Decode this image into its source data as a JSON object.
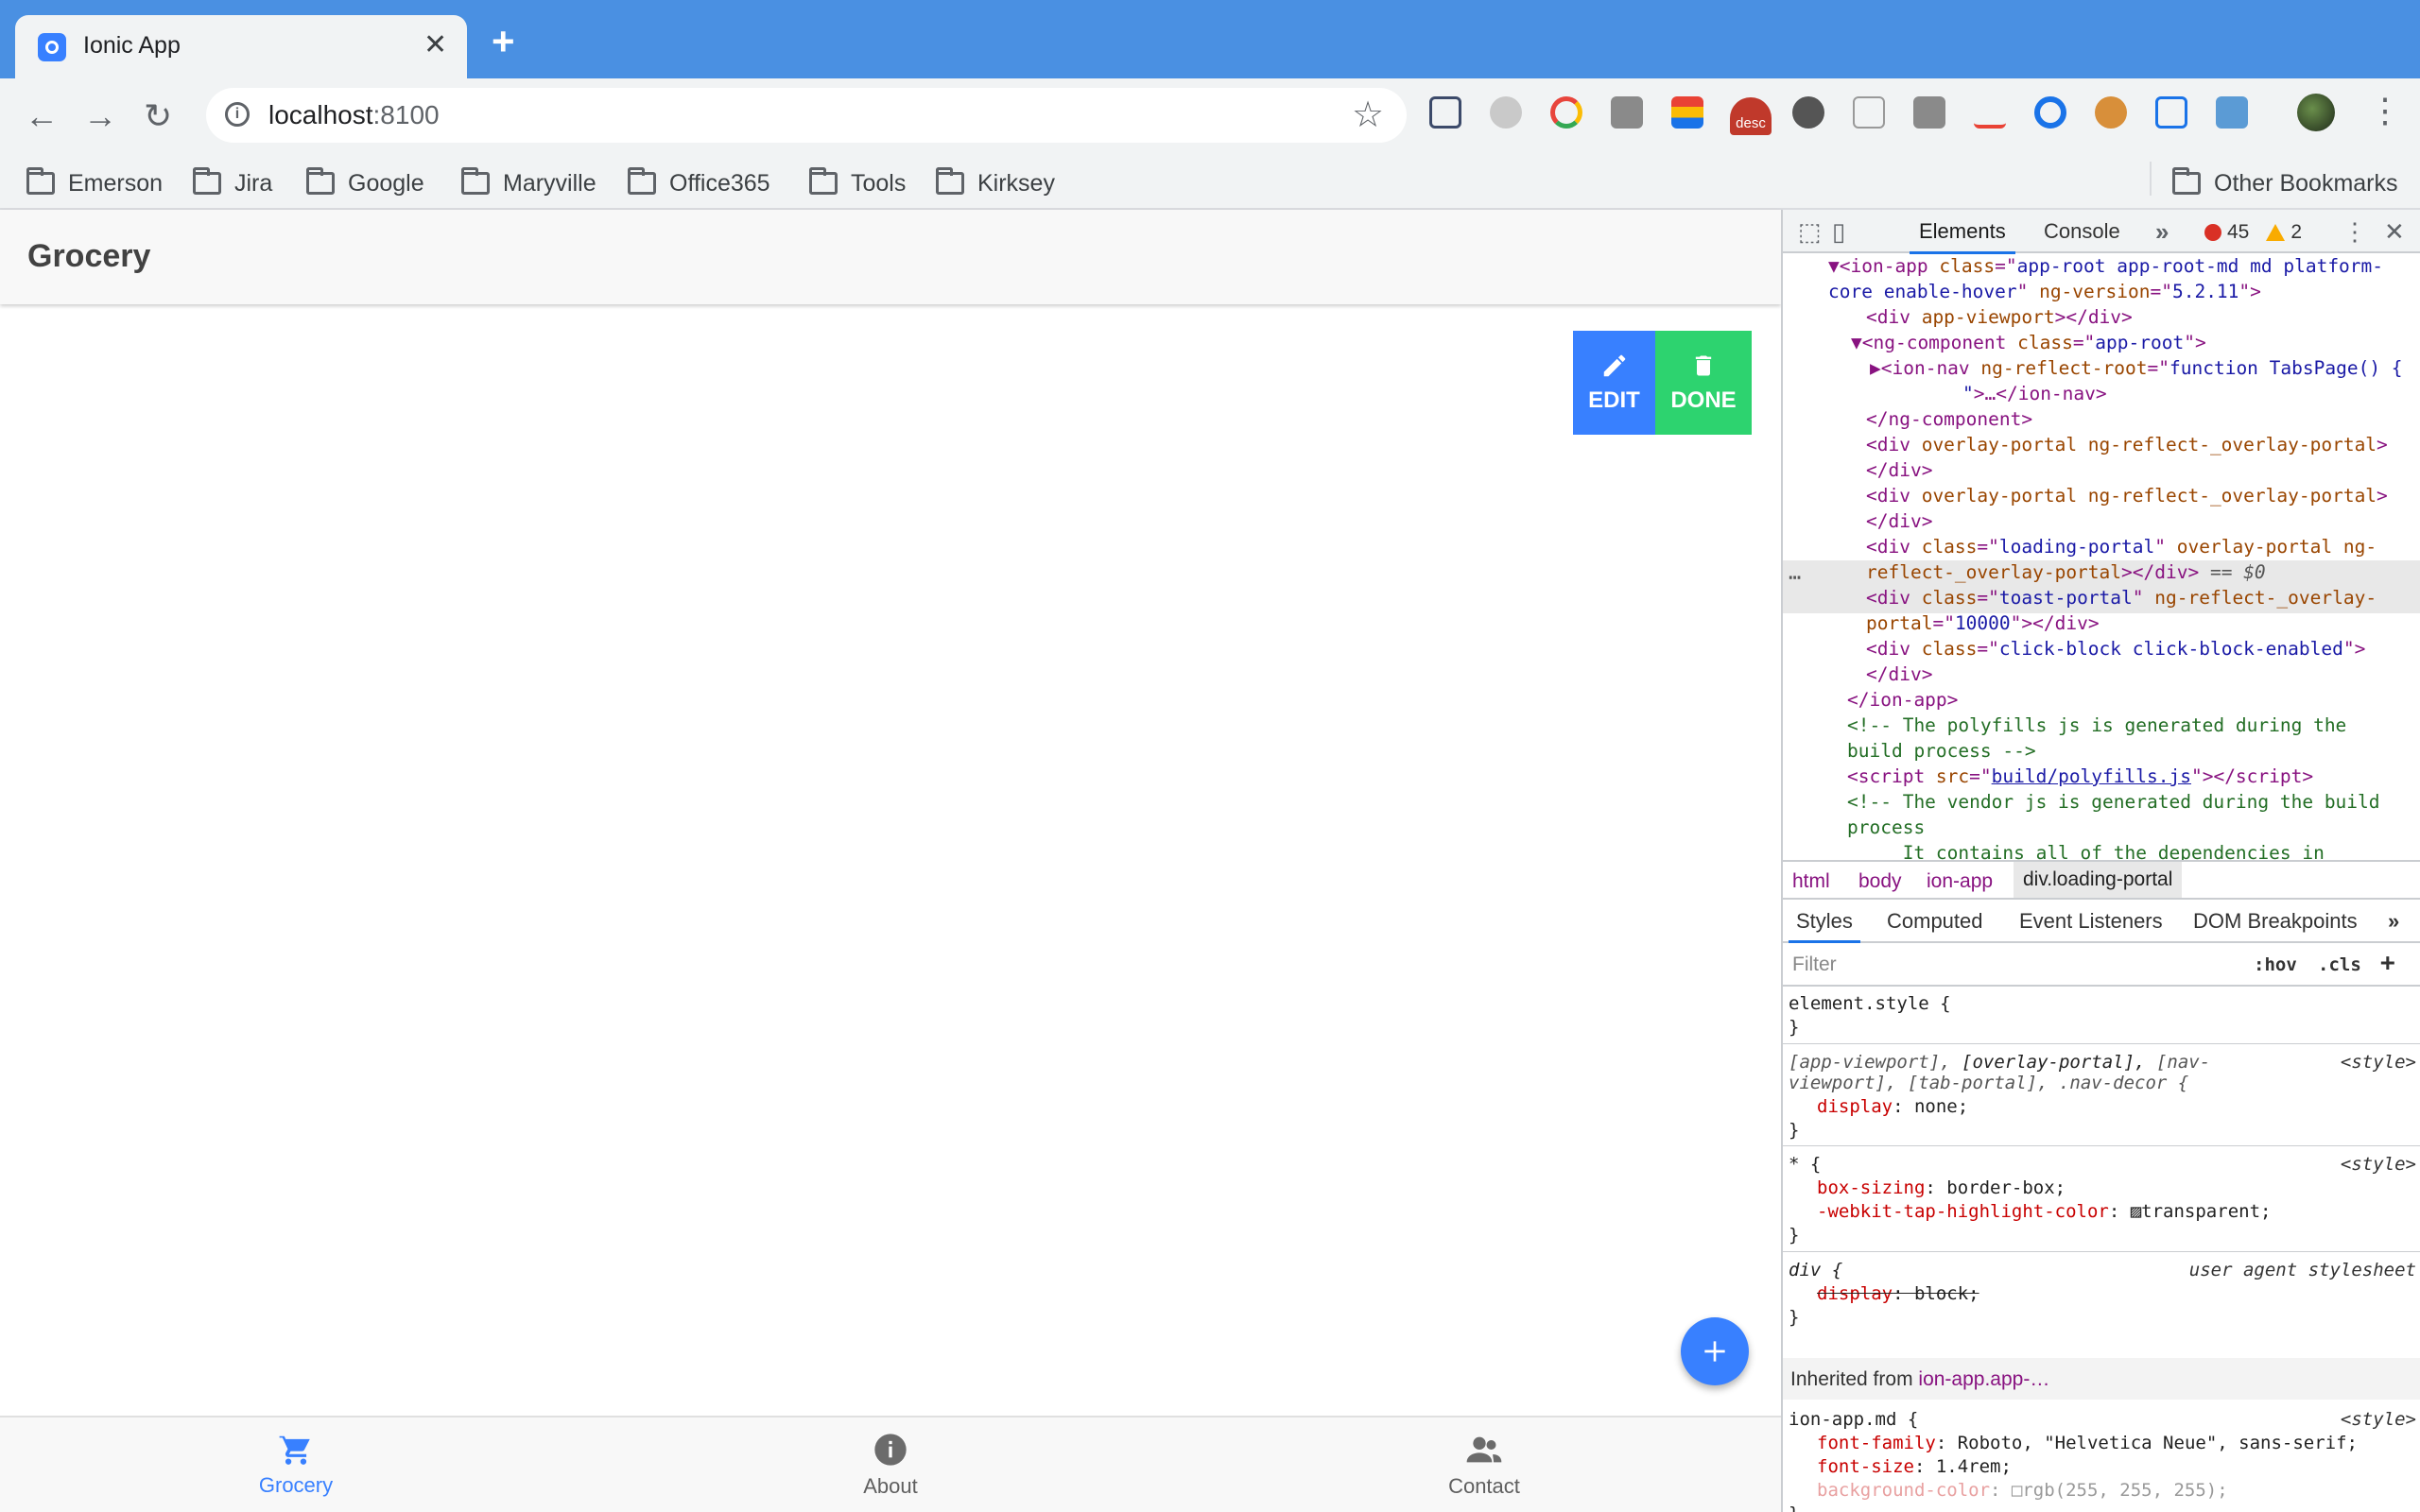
{
  "browser": {
    "tab_title": "Ionic App",
    "url_host": "localhost",
    "url_port": ":8100",
    "bookmarks": [
      "Emerson",
      "Jira",
      "Google",
      "Maryville",
      "Office365",
      "Tools",
      "Kirksey"
    ],
    "other_bookmarks": "Other Bookmarks",
    "extension_badge": "desc"
  },
  "app": {
    "title": "Grocery",
    "edit_label": "EDIT",
    "done_label": "DONE",
    "tabs": [
      "Grocery",
      "About",
      "Contact"
    ],
    "colors": {
      "primary": "#3880ff",
      "success": "#2dd36f"
    }
  },
  "devtools": {
    "tabs": [
      "Elements",
      "Console"
    ],
    "error_count": "45",
    "warning_count": "2",
    "breadcrumbs": [
      "html",
      "body",
      "ion-app",
      "div.loading-portal"
    ],
    "sub_tabs": [
      "Styles",
      "Computed",
      "Event Listeners",
      "DOM Breakpoints"
    ],
    "filter_placeholder": "Filter",
    "hov": ":hov",
    "cls": ".cls",
    "inherited_label": "Inherited from",
    "inherited_from": "ion-app.app-…"
  }
}
